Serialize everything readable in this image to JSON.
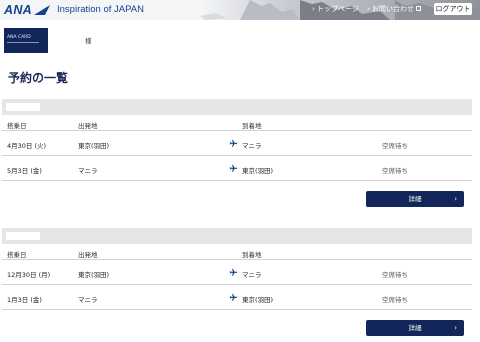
{
  "header": {
    "logo": "ANA",
    "tagline": "Inspiration of JAPAN",
    "nav_top": "› トップページ",
    "nav_contact": "› お問い合わせ",
    "logout": "ログアウト"
  },
  "member": {
    "card_text": "ANA CARD",
    "honorific": "様"
  },
  "page_title": "予約の一覧",
  "columns": {
    "date": "搭乗日",
    "departure": "出発地",
    "arrival": "到着地"
  },
  "reservations": [
    {
      "flights": [
        {
          "date": "4月30日 (火)",
          "departure": "東京(羽田)",
          "arrival": "マニラ",
          "status": "空席待ち"
        },
        {
          "date": "5月3日 (金)",
          "departure": "マニラ",
          "arrival": "東京(羽田)",
          "status": "空席待ち"
        }
      ],
      "detail_label": "詳細"
    },
    {
      "flights": [
        {
          "date": "12月30日 (月)",
          "departure": "東京(羽田)",
          "arrival": "マニラ",
          "status": "空席待ち"
        },
        {
          "date": "1月3日 (金)",
          "departure": "マニラ",
          "arrival": "東京(羽田)",
          "status": "空席待ち"
        }
      ],
      "detail_label": "詳細"
    }
  ],
  "icons": {
    "flight": "airplane-icon",
    "chevron": "chevron-right-icon",
    "external": "external-link-icon"
  },
  "colors": {
    "brand": "#13448f",
    "navy": "#13265a",
    "bar": "#e6e6e6"
  }
}
